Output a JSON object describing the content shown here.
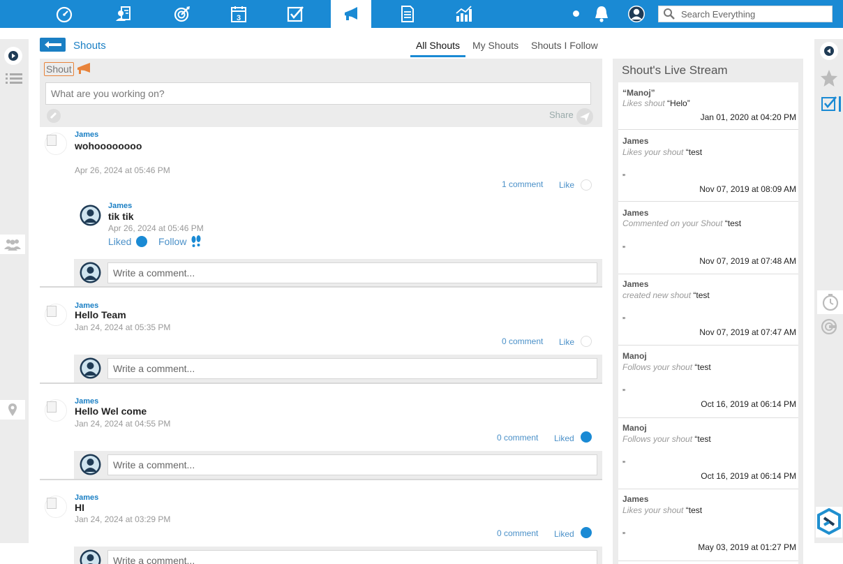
{
  "search": {
    "placeholder": "Search Everything"
  },
  "nav": {
    "items": [
      "dashboard-icon",
      "contacts-icon",
      "goals-icon",
      "calendar-icon",
      "tasks-icon",
      "shouts-icon",
      "documents-icon",
      "reports-icon"
    ],
    "calendar_day": "3"
  },
  "header": {
    "title": "Shouts"
  },
  "tabs": [
    "All Shouts",
    "My Shouts",
    "Shouts I Follow"
  ],
  "composer": {
    "label": "Shout",
    "placeholder": "What are you working on?",
    "share": "Share"
  },
  "posts": [
    {
      "author": "James",
      "text": "wohoooooooo",
      "date": "Apr 26, 2024 at 05:46 PM",
      "comments": "1 comment",
      "like": "Like",
      "reply": {
        "author": "James",
        "text": "tik tik",
        "date": "Apr 26, 2024 at 05:46 PM",
        "liked": "Liked",
        "follow": "Follow"
      },
      "comment_placeholder": "Write a comment..."
    },
    {
      "author": "James",
      "text": "Hello Team",
      "date": "Jan 24, 2024 at 05:35 PM",
      "comments": "0 comment",
      "like": "Like",
      "comment_placeholder": "Write a comment..."
    },
    {
      "author": "James",
      "text": "Hello Wel come",
      "date": "Jan 24, 2024 at 04:55 PM",
      "comments": "0 comment",
      "like": "Liked",
      "comment_placeholder": "Write a comment..."
    },
    {
      "author": "James",
      "text": "HI",
      "date": "Jan 24, 2024 at 03:29 PM",
      "comments": "0 comment",
      "like": "Liked",
      "comment_placeholder": "Write a comment..."
    }
  ],
  "stream": {
    "title": "Shout's Live Stream",
    "items": [
      {
        "name": "“Manoj”",
        "action": "Likes shout",
        "quote": "“Helo”",
        "close": "",
        "date": "Jan 01, 2020 at 04:20 PM"
      },
      {
        "name": "James",
        "action": "Likes your shout",
        "quote": "“test",
        "close": "”",
        "date": "Nov 07, 2019 at 08:09 AM"
      },
      {
        "name": "James",
        "action": "Commented on your Shout",
        "quote": "“test",
        "close": "”",
        "date": "Nov 07, 2019 at 07:48 AM"
      },
      {
        "name": "James",
        "action": "created new shout",
        "quote": "“test",
        "close": "”",
        "date": "Nov 07, 2019 at 07:47 AM"
      },
      {
        "name": "Manoj",
        "action": "Follows your shout",
        "quote": "“test",
        "close": "”",
        "date": "Oct 16, 2019 at 06:14 PM"
      },
      {
        "name": "Manoj",
        "action": "Follows your shout",
        "quote": "“test",
        "close": "”",
        "date": "Oct 16, 2019 at 06:14 PM"
      },
      {
        "name": "James",
        "action": "Likes your shout",
        "quote": "“test",
        "close": "”",
        "date": "May 03, 2019 at 01:27 PM"
      }
    ]
  },
  "colors": {
    "primary": "#1a8ad4",
    "accent_orange": "#e8833a",
    "panel_bg": "#ececec"
  }
}
